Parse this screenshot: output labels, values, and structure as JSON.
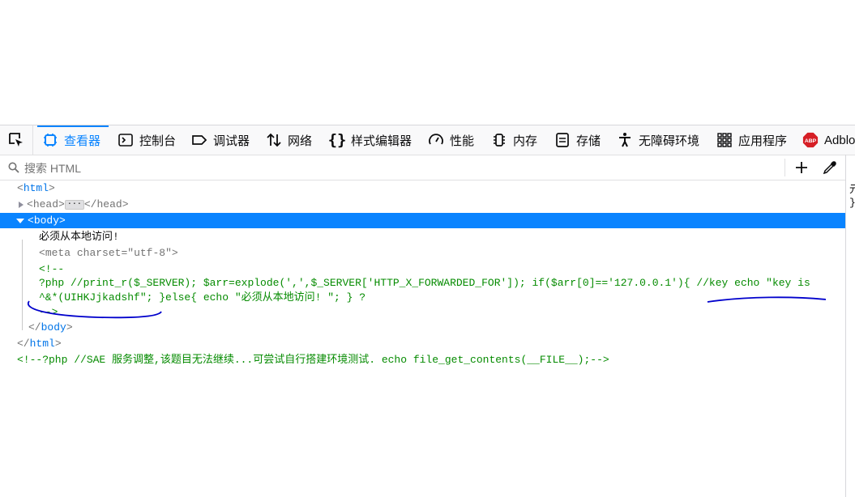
{
  "devtools": {
    "tabs": [
      {
        "label": "查看器",
        "icon": "inspector-icon",
        "active": true
      },
      {
        "label": "控制台",
        "icon": "console-icon"
      },
      {
        "label": "调试器",
        "icon": "debugger-icon"
      },
      {
        "label": "网络",
        "icon": "network-icon"
      },
      {
        "label": "样式编辑器",
        "icon": "style-editor-icon"
      },
      {
        "label": "性能",
        "icon": "performance-icon"
      },
      {
        "label": "内存",
        "icon": "memory-icon"
      },
      {
        "label": "存储",
        "icon": "storage-icon"
      },
      {
        "label": "无障碍环境",
        "icon": "accessibility-icon"
      },
      {
        "label": "应用程序",
        "icon": "application-icon"
      },
      {
        "label": "Adblo",
        "icon": "abp-icon"
      }
    ],
    "abp_badge": "ABP",
    "search": {
      "placeholder": "搜索 HTML"
    },
    "side_panel": {
      "line1": "元",
      "line2": "}"
    }
  },
  "markup": {
    "html_tag": "html",
    "head_tag": "head",
    "body_tag": "body",
    "body_text": "必须从本地访问!",
    "meta": {
      "tag": "meta",
      "attr": "charset",
      "value": "utf-8"
    },
    "comment_open": "<!--",
    "comment_line1": "?php //print_r($_SERVER); $arr=explode(',',$_SERVER['HTTP_X_FORWARDED_FOR']); if($arr[0]=='127.0.0.1'){ //key echo \"key is",
    "comment_line2": "^&*(UIHKJjkadshf\"; }else{ echo \"必须从本地访问! \"; } ?",
    "comment_close": "-->",
    "trailing_comment": "<!--?php //SAE 服务调整,该题目无法继续...可尝试自行搭建环境测试. echo file_get_contents(__FILE__);-->"
  },
  "colors": {
    "accent": "#0a84ff",
    "comment": "#058b00",
    "annotation": "#0000cc"
  }
}
